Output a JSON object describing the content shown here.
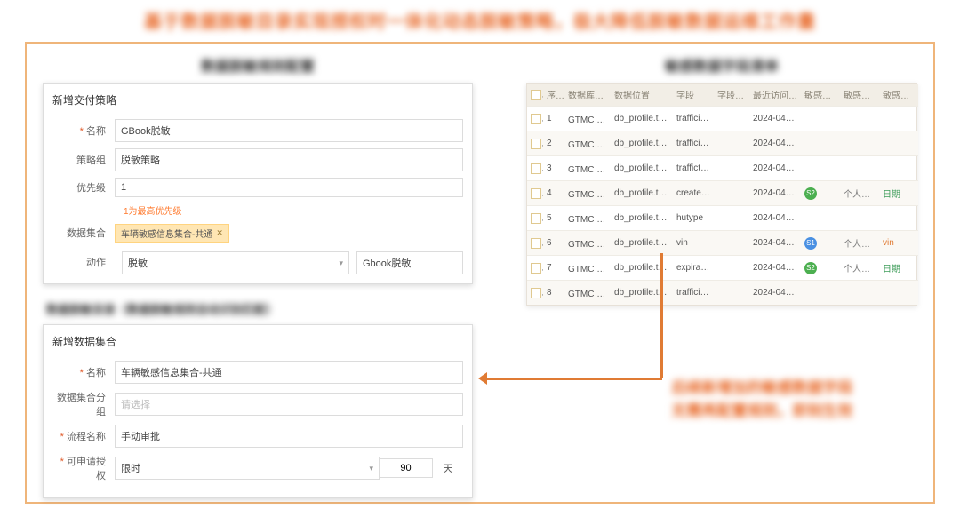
{
  "headline": "基于数据脱敏目录实现授权时一体化动态脱敏策略，极大降低脱敏数据运维工作量",
  "left": {
    "section_title": "数据脱敏规则配置",
    "panel1": {
      "title": "新增交付策略",
      "name_label": "名称",
      "name_value": "GBook脱敏",
      "group_label": "策略组",
      "group_value": "脱敏策略",
      "priority_label": "优先级",
      "priority_value": "1",
      "priority_hint": "1为最高优先级",
      "dataset_label": "数据集合",
      "dataset_tag": "车辆敏感信息集合-共通",
      "action_label": "动作",
      "action_value": "脱敏",
      "action_side": "Gbook脱敏"
    },
    "mid_subtitle": "数据脱敏目录（数据脱敏规则自动识别匹配）",
    "panel2": {
      "title": "新增数据集合",
      "name_label": "名称",
      "name_value": "车辆敏感信息集合-共通",
      "group_label": "数据集合分组",
      "group_placeholder": "请选择",
      "flow_label": "流程名称",
      "flow_value": "手动审批",
      "auth_label": "可申请授权",
      "auth_value": "限时",
      "auth_days": "90",
      "auth_unit": "天"
    }
  },
  "right": {
    "section_title": "敏感数据字段清单",
    "table": {
      "headers": [
        "",
        "序号",
        "数据库实例",
        "数据位置",
        "字段",
        "字段注释",
        "最近访问日期",
        "敏感数据级别",
        "敏感数据类别",
        "敏感数据类型"
      ],
      "rows": [
        {
          "idx": "1",
          "db": "GTMC · 整...",
          "loc": "db_profile.tbltr...",
          "field": "trafficinfo",
          "note": "",
          "date": "2024-04-18...",
          "badge": "",
          "level": "",
          "type": ""
        },
        {
          "idx": "2",
          "db": "GTMC · 整...",
          "loc": "db_profile.tbltr...",
          "field": "trafficinf...",
          "note": "",
          "date": "2024-04-18...",
          "badge": "",
          "level": "",
          "type": ""
        },
        {
          "idx": "3",
          "db": "GTMC · 整...",
          "loc": "db_profile.tbltr...",
          "field": "trafficto...",
          "note": "",
          "date": "2024-04-18...",
          "badge": "",
          "level": "",
          "type": ""
        },
        {
          "idx": "4",
          "db": "GTMC · 整...",
          "loc": "db_profile.tbltr...",
          "field": "created...",
          "note": "",
          "date": "2024-04-18...",
          "badge": "S2",
          "badgeClass": "g",
          "level": "个人敏...",
          "type": "日期",
          "typeClass": "type"
        },
        {
          "idx": "5",
          "db": "GTMC · 整...",
          "loc": "db_profile.tbltr...",
          "field": "hutype",
          "note": "",
          "date": "2024-04-18...",
          "badge": "",
          "level": "",
          "type": ""
        },
        {
          "idx": "6",
          "db": "GTMC · 整...",
          "loc": "db_profile.tbltr...",
          "field": "vin",
          "note": "",
          "date": "2024-04-18...",
          "badge": "S1",
          "badgeClass": "b",
          "level": "个人敏...",
          "type": "vin",
          "typeClass": "type orange"
        },
        {
          "idx": "7",
          "db": "GTMC · 整...",
          "loc": "db_profile.tbltr...",
          "field": "expirati...",
          "note": "",
          "date": "2024-04-18...",
          "badge": "S2",
          "badgeClass": "g",
          "level": "个人敏...",
          "type": "日期",
          "typeClass": "type"
        },
        {
          "idx": "8",
          "db": "GTMC · 整...",
          "loc": "db_profile.tbltr...",
          "field": "trafficinf...",
          "note": "",
          "date": "2024-04-18...",
          "badge": "",
          "level": "",
          "type": ""
        }
      ]
    }
  },
  "arrow_caption_l1": "后续新增加的敏感数据字段",
  "arrow_caption_l2": "无需再配置规则，即刻生效"
}
